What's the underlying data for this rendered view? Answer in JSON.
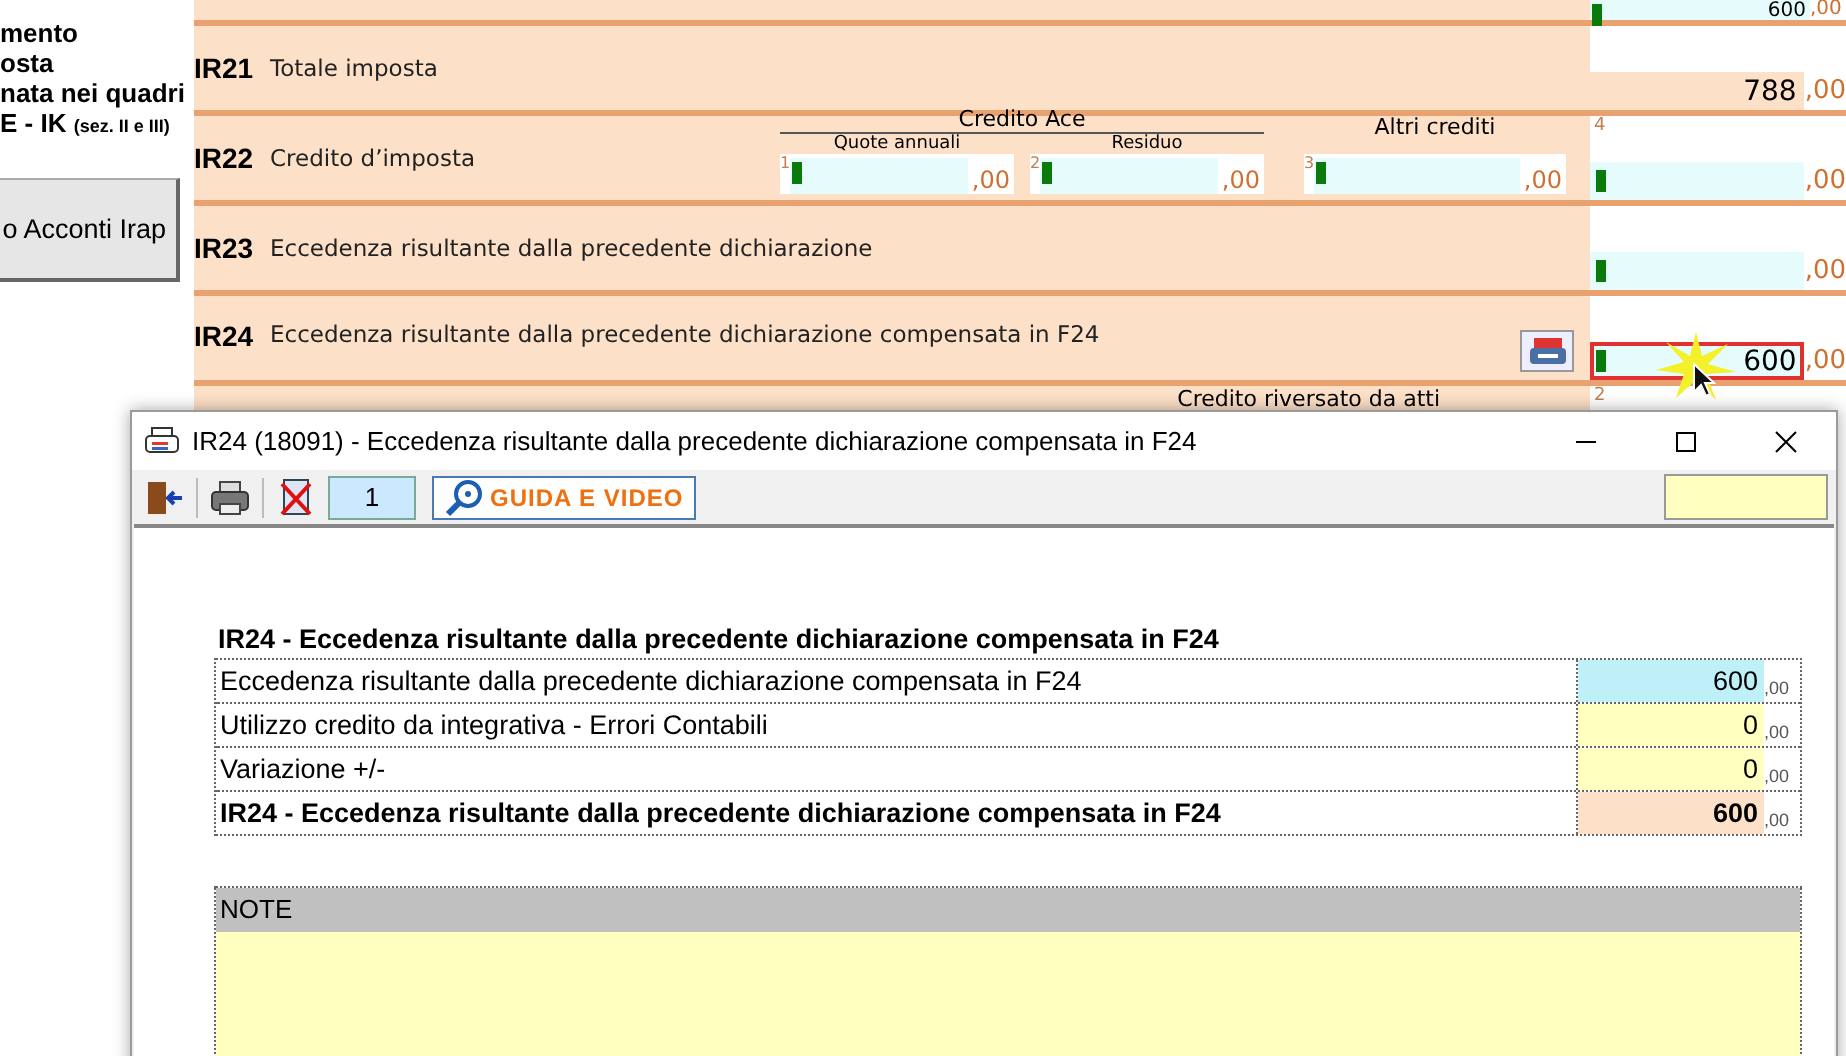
{
  "sidebar": {
    "lines": [
      "mento",
      "osta",
      "nata nei quadri"
    ],
    "last_line": {
      "text": "E - IK",
      "note": "(sez. II e III)"
    },
    "button": "o Acconti Irap"
  },
  "form": {
    "rows": [
      {
        "kind": "partial",
        "field": {
          "kind": "input",
          "value": "600",
          "decimals": ",00",
          "highlighted": false
        }
      },
      {
        "kind": "simple",
        "code": "IR21",
        "label": "Totale imposta",
        "field": {
          "kind": "computed",
          "value": "788",
          "decimals": ",00",
          "highlighted": false
        }
      },
      {
        "kind": "credits",
        "code": "IR22",
        "label": "Credito d’imposta",
        "group": {
          "title": "Credito Ace",
          "fields": [
            {
              "caption": "Quote annuali",
              "number": "1",
              "decimals": ",00"
            },
            {
              "caption": "Residuo",
              "number": "2",
              "decimals": ",00"
            }
          ]
        },
        "other_field": {
          "caption": "Altri crediti",
          "number": "3",
          "decimals": ",00"
        },
        "field": {
          "kind": "input",
          "number": "4",
          "decimals": ",00",
          "highlighted": false
        }
      },
      {
        "kind": "simple",
        "code": "IR23",
        "label": "Eccedenza risultante dalla precedente dichiarazione",
        "field": {
          "kind": "input",
          "decimals": ",00",
          "highlighted": false
        }
      },
      {
        "kind": "simple",
        "code": "IR24",
        "label": "Eccedenza risultante dalla precedente dichiarazione compensata in F24",
        "has_button": true,
        "field": {
          "kind": "input",
          "value": "600",
          "decimals": ",00",
          "highlighted": true
        }
      },
      {
        "kind": "caption",
        "caption": "Credito riversato da atti",
        "number": "2"
      }
    ]
  },
  "dialog": {
    "title": "IR24 (18091) - Eccedenza risultante dalla precedente dichiarazione compensata in F24",
    "page": "1",
    "guide_button": "GUIDA E VIDEO",
    "heading": "IR24 - Eccedenza risultante dalla precedente dichiarazione compensata in F24",
    "rows": [
      {
        "kind": "input",
        "label": "Eccedenza risultante dalla precedente dichiarazione compensata in F24",
        "value": "600",
        "decimals": ",00"
      },
      {
        "kind": "editable",
        "label": "Utilizzo credito da integrativa - Errori Contabili",
        "value": "0",
        "decimals": ",00"
      },
      {
        "kind": "editable",
        "label": "Variazione +/-",
        "value": "0",
        "decimals": ",00"
      },
      {
        "kind": "total",
        "label": "IR24 - Eccedenza risultante dalla precedente dichiarazione compensata in F24",
        "value": "600",
        "decimals": ",00"
      }
    ],
    "notes_header": "NOTE"
  }
}
